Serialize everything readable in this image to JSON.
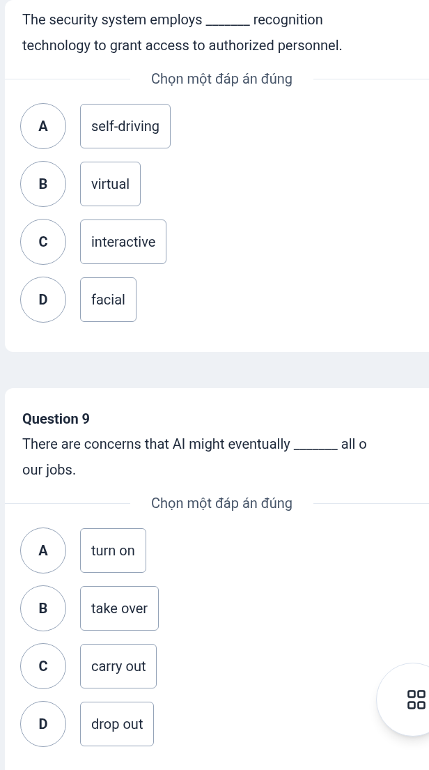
{
  "questions": [
    {
      "lines": [
        "The security system employs _______ recognition",
        "technology to grant access to authorized personnel."
      ],
      "instruction": "Chọn một đáp án đúng",
      "options": [
        {
          "letter": "A",
          "text": "self-driving"
        },
        {
          "letter": "B",
          "text": "virtual"
        },
        {
          "letter": "C",
          "text": "interactive"
        },
        {
          "letter": "D",
          "text": "facial"
        }
      ]
    },
    {
      "title": "Question 9",
      "lines": [
        "There are concerns that AI might eventually _______ all o",
        "our jobs."
      ],
      "instruction": "Chọn một đáp án đúng",
      "options": [
        {
          "letter": "A",
          "text": "turn on"
        },
        {
          "letter": "B",
          "text": "take over"
        },
        {
          "letter": "C",
          "text": "carry out"
        },
        {
          "letter": "D",
          "text": "drop out"
        }
      ]
    }
  ]
}
